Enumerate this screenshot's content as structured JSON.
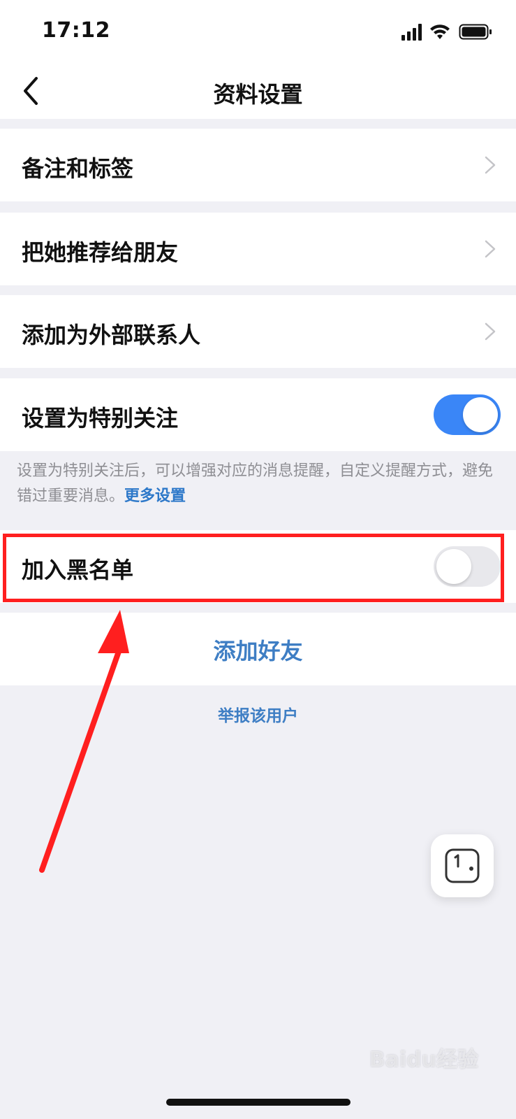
{
  "status_bar": {
    "time": "17:12"
  },
  "nav": {
    "title": "资料设置"
  },
  "rows": [
    {
      "label": "备注和标签"
    },
    {
      "label": "把她推荐给朋友"
    },
    {
      "label": "添加为外部联系人"
    }
  ],
  "special_follow": {
    "label": "设置为特别关注",
    "on": true,
    "description": "设置为特别关注后，可以增强对应的消息提醒，自定义提醒方式，避免错过重要消息。",
    "more_link": "更多设置"
  },
  "blacklist": {
    "label": "加入黑名单",
    "on": false
  },
  "add_friend_label": "添加好友",
  "report_label": "举报该用户",
  "watermark": "Baidu经验",
  "colors": {
    "toggle_on": "#3a86f7",
    "link": "#3e7ec4",
    "annotation": "#ff1f1f"
  },
  "icons": {
    "back": "chevron-left-icon",
    "row_arrow": "chevron-right-icon",
    "float": "floating-window-icon"
  }
}
